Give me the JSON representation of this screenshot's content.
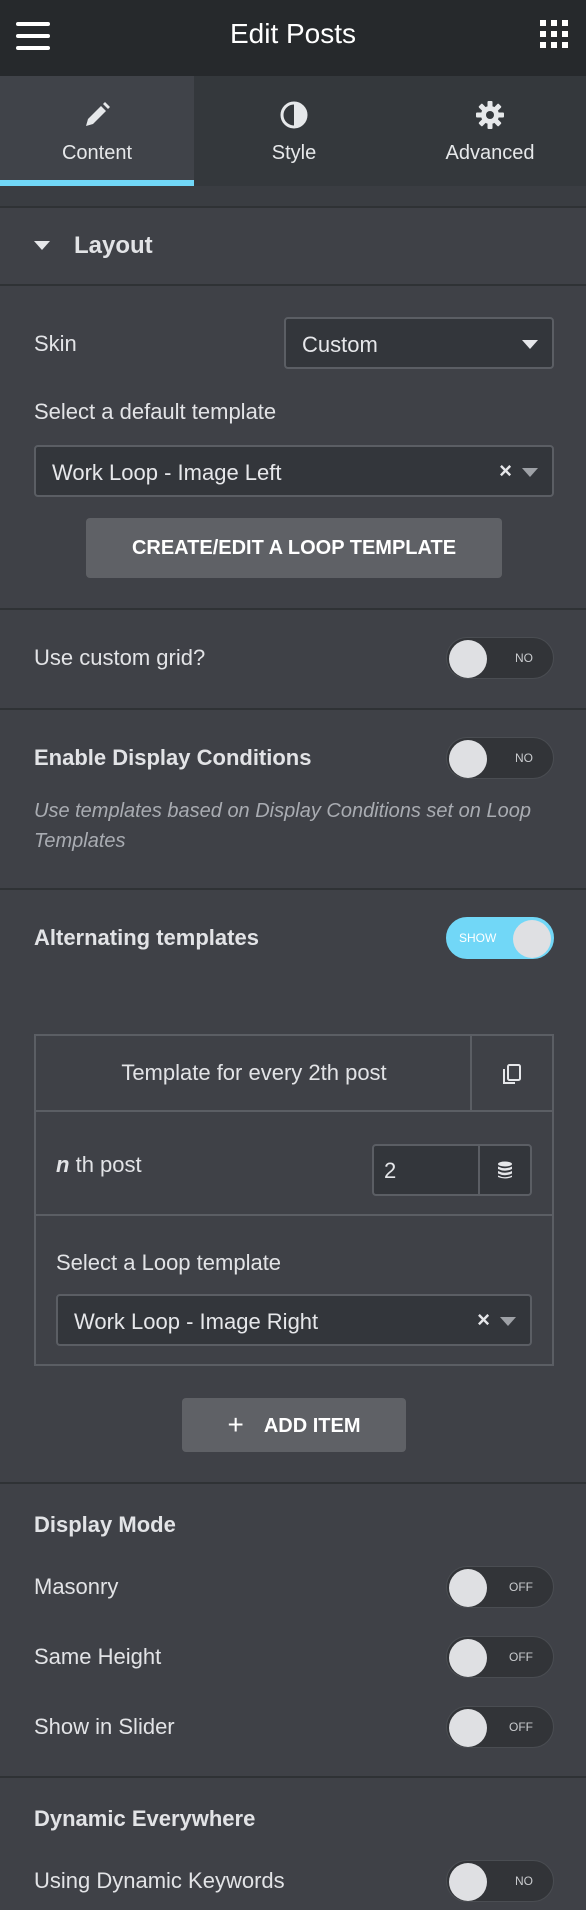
{
  "header": {
    "title": "Edit Posts",
    "menu_icon": "hamburger-menu-icon",
    "apps_icon": "grid-apps-icon"
  },
  "tabs": [
    {
      "label": "Content",
      "icon": "pencil-icon",
      "active": true
    },
    {
      "label": "Style",
      "icon": "half-circle-contrast-icon",
      "active": false
    },
    {
      "label": "Advanced",
      "icon": "gear-icon",
      "active": false
    }
  ],
  "colors": {
    "accent": "#71d7f7",
    "header_bg": "#26292c",
    "panel_bg": "#3f4147"
  },
  "layout_section": {
    "title": "Layout",
    "skin_label": "Skin",
    "skin_value": "Custom",
    "default_template_label": "Select a default template",
    "default_template_value": "Work Loop - Image Left",
    "create_button": "CREATE/EDIT A LOOP TEMPLATE"
  },
  "custom_grid": {
    "label": "Use custom grid?",
    "state": "NO"
  },
  "display_conditions": {
    "label": "Enable Display Conditions",
    "state": "NO",
    "note": "Use templates based on Display Conditions set on Loop Templates"
  },
  "alternating": {
    "label": "Alternating templates",
    "state": "SHOW",
    "item": {
      "title": "Template for every 2th post",
      "nth_label_n": "n",
      "nth_label": "th post",
      "nth_value": "2",
      "loop_template_label": "Select a Loop template",
      "loop_template_value": "Work Loop - Image Right"
    },
    "add_item": "ADD ITEM"
  },
  "display_mode": {
    "title": "Display Mode",
    "masonry": {
      "label": "Masonry",
      "state": "OFF"
    },
    "same_height": {
      "label": "Same Height",
      "state": "OFF"
    },
    "slider": {
      "label": "Show in Slider",
      "state": "OFF"
    }
  },
  "dynamic": {
    "title": "Dynamic Everywhere",
    "keywords": {
      "label": "Using Dynamic Keywords",
      "state": "NO"
    }
  }
}
